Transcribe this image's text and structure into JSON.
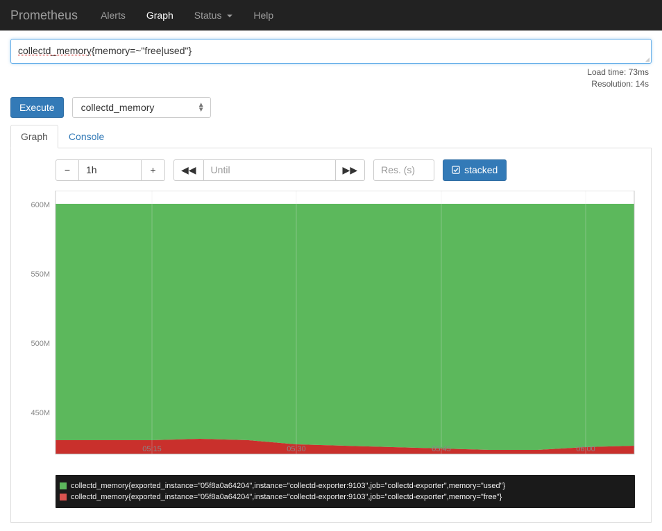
{
  "navbar": {
    "brand": "Prometheus",
    "items": [
      "Alerts",
      "Graph",
      "Status",
      "Help"
    ],
    "active_index": 1,
    "status_has_caret": true
  },
  "expression": {
    "value": "collectd_memory{memory=~\"free|used\"}",
    "spellcheck_part": "collectd_memory",
    "rest_part": "{memory=~\"free|used\"}"
  },
  "load_info": {
    "load_time": "Load time: 73ms",
    "resolution": "Resolution: 14s"
  },
  "execute_label": "Execute",
  "metric_select": "collectd_memory",
  "tabs": {
    "graph": "Graph",
    "console": "Console",
    "active": "graph"
  },
  "controls": {
    "minus": "−",
    "range": "1h",
    "plus": "+",
    "until_placeholder": "Until",
    "res_placeholder": "Res. (s)",
    "stacked": "stacked"
  },
  "chart_data": {
    "type": "area",
    "stacked": true,
    "x_ticks": [
      "05:15",
      "05:30",
      "05:45",
      "06:00"
    ],
    "y_ticks": [
      "450M",
      "500M",
      "550M",
      "600M"
    ],
    "ylim": [
      420000000,
      610000000
    ],
    "series": [
      {
        "name": "collectd_memory{exported_instance=\"05f8a0a64204\",instance=\"collectd-exporter:9103\",job=\"collectd-exporter\",memory=\"used\"}",
        "color": "#5cb85c",
        "approx_level": 605000000
      },
      {
        "name": "collectd_memory{exported_instance=\"05f8a0a64204\",instance=\"collectd-exporter:9103\",job=\"collectd-exporter\",memory=\"free\"}",
        "color": "#c9302c",
        "approx_level": 428000000
      }
    ],
    "x": [
      "05:05",
      "05:10",
      "05:15",
      "05:20",
      "05:25",
      "05:30",
      "05:35",
      "05:40",
      "05:45",
      "05:50",
      "05:55",
      "06:00",
      "06:05"
    ],
    "red_values": [
      430,
      430,
      430,
      431,
      430,
      427,
      426,
      425,
      424,
      424,
      423,
      425,
      426
    ],
    "green_values": [
      605,
      605,
      605,
      605,
      605,
      605,
      605,
      605,
      605,
      605,
      605,
      605,
      605
    ],
    "value_unit": "M"
  },
  "legend": {
    "rows": [
      {
        "color": "green",
        "text": "collectd_memory{exported_instance=\"05f8a0a64204\",instance=\"collectd-exporter:9103\",job=\"collectd-exporter\",memory=\"used\"}"
      },
      {
        "color": "red",
        "text": "collectd_memory{exported_instance=\"05f8a0a64204\",instance=\"collectd-exporter:9103\",job=\"collectd-exporter\",memory=\"free\"}"
      }
    ]
  }
}
